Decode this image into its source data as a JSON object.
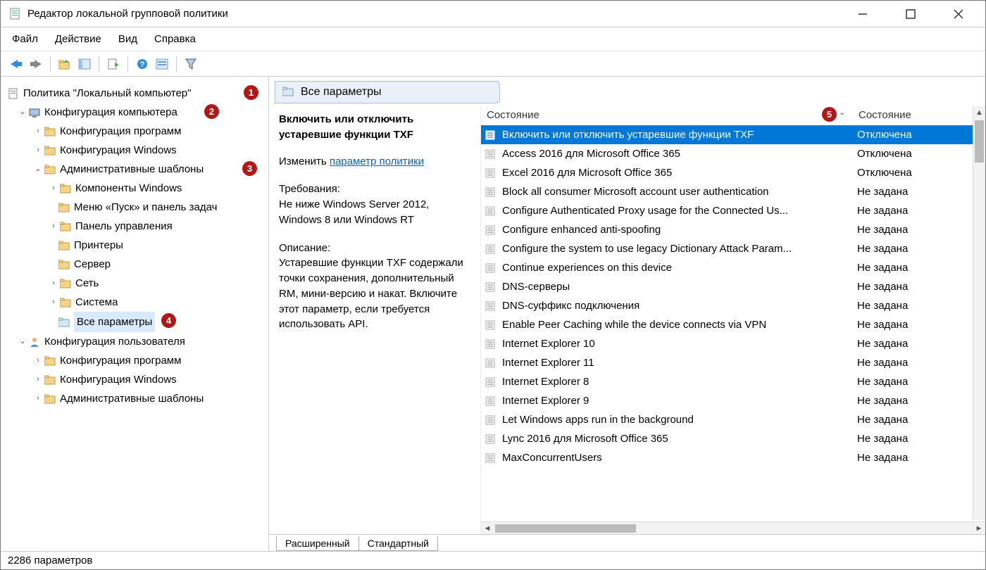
{
  "window": {
    "title": "Редактор локальной групповой политики"
  },
  "menu": {
    "file": "Файл",
    "action": "Действие",
    "view": "Вид",
    "help": "Справка"
  },
  "tree": {
    "root": "Политика \"Локальный компьютер\"",
    "comp_cfg": "Конфигурация компьютера",
    "soft_cfg": "Конфигурация программ",
    "win_cfg": "Конфигурация Windows",
    "admin_tpl": "Административные шаблоны",
    "win_comp": "Компоненты Windows",
    "start_menu": "Меню «Пуск» и панель задач",
    "ctrl_panel": "Панель управления",
    "printers": "Принтеры",
    "server": "Сервер",
    "network": "Сеть",
    "system": "Система",
    "all_settings": "Все параметры",
    "user_cfg": "Конфигурация пользователя",
    "u_soft_cfg": "Конфигурация программ",
    "u_win_cfg": "Конфигурация Windows",
    "u_admin_tpl": "Административные шаблоны"
  },
  "header": {
    "title": "Все параметры"
  },
  "detail": {
    "title": "Включить или отключить устаревшие функции TXF",
    "edit_label": "Изменить",
    "link": "параметр политики",
    "req_label": "Требования:",
    "req_text": "Не ниже Windows Server 2012, Windows 8 или Windows RT",
    "desc_label": "Описание:",
    "desc_text": "Устаревшие функции TXF содержали точки сохранения, дополнительный RM, мини-версию и накат. Включите этот параметр, если требуется использовать API."
  },
  "columns": {
    "name": "Состояние",
    "state": "Состояние"
  },
  "rows": [
    {
      "name": "Включить или отключить устаревшие функции TXF",
      "state": "Отключена",
      "sel": true
    },
    {
      "name": "Access 2016 для Microsoft Office 365",
      "state": "Отключена"
    },
    {
      "name": "Excel 2016 для Microsoft Office 365",
      "state": "Отключена"
    },
    {
      "name": "Block all consumer Microsoft account user authentication",
      "state": "Не задана"
    },
    {
      "name": "Configure Authenticated Proxy usage for the Connected Us...",
      "state": "Не задана"
    },
    {
      "name": "Configure enhanced anti-spoofing",
      "state": "Не задана"
    },
    {
      "name": "Configure the system to use legacy Dictionary Attack Param...",
      "state": "Не задана"
    },
    {
      "name": "Continue experiences on this device",
      "state": "Не задана"
    },
    {
      "name": "DNS-серверы",
      "state": "Не задана"
    },
    {
      "name": "DNS-суффикс подключения",
      "state": "Не задана"
    },
    {
      "name": "Enable Peer Caching while the device connects via VPN",
      "state": "Не задана"
    },
    {
      "name": "Internet Explorer 10",
      "state": "Не задана"
    },
    {
      "name": "Internet Explorer 11",
      "state": "Не задана"
    },
    {
      "name": "Internet Explorer 8",
      "state": "Не задана"
    },
    {
      "name": "Internet Explorer 9",
      "state": "Не задана"
    },
    {
      "name": "Let Windows apps run in the background",
      "state": "Не задана"
    },
    {
      "name": "Lync 2016 для Microsoft Office 365",
      "state": "Не задана"
    },
    {
      "name": "MaxConcurrentUsers",
      "state": "Не задана"
    }
  ],
  "tabs": {
    "ext": "Расширенный",
    "std": "Стандартный"
  },
  "status": "2286 параметров",
  "badges": [
    "1",
    "2",
    "3",
    "4",
    "5"
  ]
}
